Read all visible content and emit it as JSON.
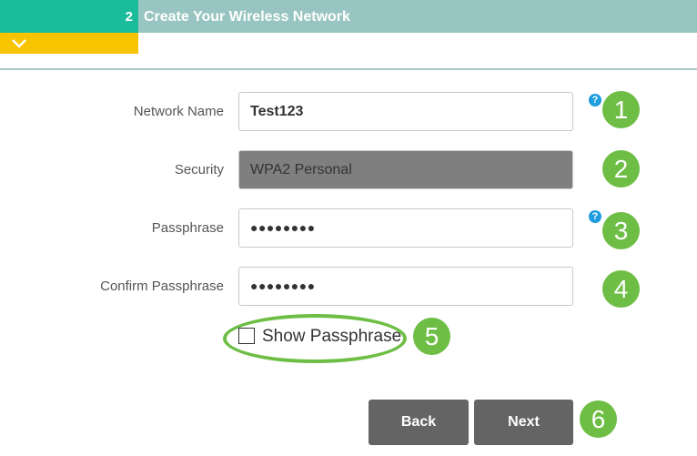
{
  "header": {
    "step_number": "2",
    "step_title": "Create Your Wireless Network",
    "collapse_icon": "chevron-down-icon"
  },
  "form": {
    "network_name": {
      "label": "Network Name",
      "value": "Test123",
      "help_icon": "?"
    },
    "security": {
      "label": "Security",
      "value": "WPA2 Personal"
    },
    "passphrase": {
      "label": "Passphrase",
      "value": "●●●●●●●●",
      "help_icon": "?"
    },
    "confirm_passphrase": {
      "label": "Confirm Passphrase",
      "value": "●●●●●●●●"
    },
    "show_passphrase": {
      "label": "Show Passphrase",
      "checked": false
    }
  },
  "buttons": {
    "back": "Back",
    "next": "Next"
  },
  "annotations": [
    "1",
    "2",
    "3",
    "4",
    "5",
    "6"
  ],
  "colors": {
    "step_green": "#1bbc9b",
    "title_teal": "#98c5c1",
    "collapse_yellow": "#f8c301",
    "badge_green": "#6ebe45",
    "help_blue": "#1d9ce0",
    "button_gray": "#646464"
  }
}
